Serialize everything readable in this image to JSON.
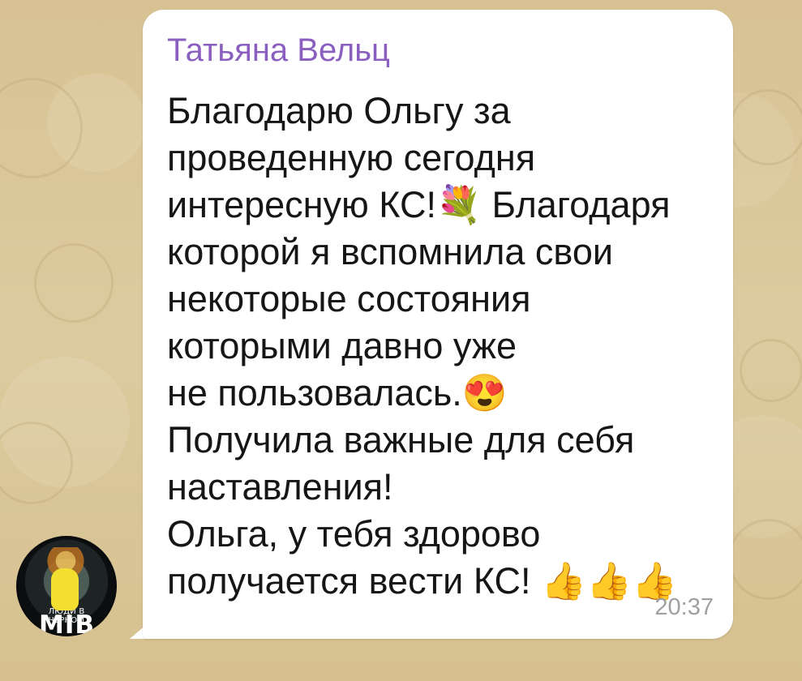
{
  "chat": {
    "message": {
      "sender_name": "Татьяна Вельц",
      "text": "Благодарю Ольгу за\nпроведенную сегодня\nинтересную КС!💐 Благодаря\nкоторой я вспомнила свои\nнекоторые состояния\nкоторыми давно уже\nне пользовалась.😍\nПолучила важные для себя\nнаставления!\nОльга, у тебя здорово\nполучается вести КС! 👍👍👍",
      "time": "20:37"
    },
    "avatar": {
      "caption": "ЛЮДИ В ЧЕРНОМ",
      "logo": "MIB"
    }
  },
  "colors": {
    "background": "#d9c597",
    "bubble": "#ffffff",
    "sender_name": "#8a5fc0",
    "message_text": "#161616",
    "timestamp": "#a0a0a0"
  }
}
